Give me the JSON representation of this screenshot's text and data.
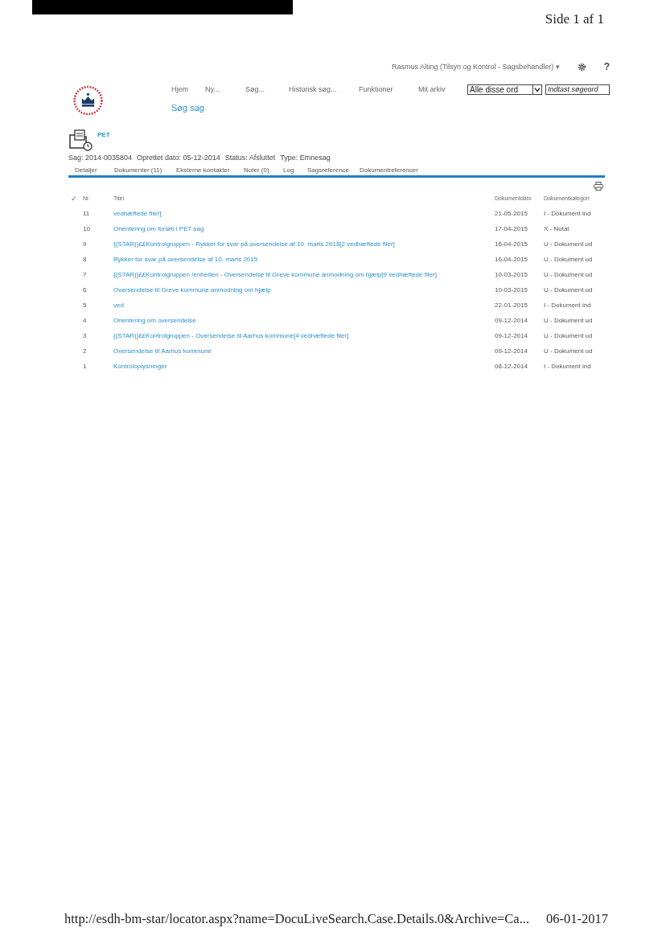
{
  "print_header": {
    "page": "Side 1 af 1"
  },
  "user_bar": {
    "user": "Rasmus Alting (Tilsyn og Kontrol - Sagsbehandler)",
    "caret": "▾",
    "help": "?"
  },
  "nav": {
    "items": [
      "Hjem",
      "Ny...",
      "Søg...",
      "Historisk søg...",
      "Funktioner",
      "Mit arkiv"
    ],
    "search_scope": "Alle disse ord",
    "search_placeholder": "Indtast søgeord",
    "sub_item": "Søg sag"
  },
  "case": {
    "label": "PET",
    "info": [
      {
        "label": "Sag:",
        "value": "2014-0035804"
      },
      {
        "label": "Oprettet dato:",
        "value": "05-12-2014"
      },
      {
        "label": "Status:",
        "value": "Afsluttet"
      },
      {
        "label": "Type:",
        "value": "Emnesag"
      }
    ]
  },
  "tabs": [
    "Detaljer",
    "Dokumenter (11)",
    "Eksterne kontakter",
    "Noter (0)",
    "Log",
    "Sagsreference",
    "Dokumentreferencer"
  ],
  "table": {
    "columns": [
      "✓",
      "Nr.",
      "Titel",
      "Dokumentdato",
      "Dokumentkategori"
    ],
    "rows": [
      {
        "nr": "11",
        "title": "vedhæftede filer]",
        "date": "21-05-2015",
        "category": "I - Dokument ind"
      },
      {
        "nr": "10",
        "title": "Orientering om forløb i PET sag",
        "date": "17-04-2015",
        "category": "X - Notat"
      },
      {
        "nr": "9",
        "title": "{(STAR)}££Kontrolgruppen - Rykker for svar på oversendelse af 10. marts 2015[2 vedhæftede filer]",
        "date": "16-04-2015",
        "category": "U - Dokument ud"
      },
      {
        "nr": "8",
        "title": "Rykker for svar på oversendelse af 10. marts 2015",
        "date": "16-04-2015",
        "category": "U - Dokument ud"
      },
      {
        "nr": "7",
        "title": "{(STAR)}££Kontrolgruppen /enheden - Oversendelse til Greve kommune anmodning om hjælp[9 vedhæftede filer]",
        "date": "10-03-2015",
        "category": "U - Dokument ud"
      },
      {
        "nr": "6",
        "title": "Oversendelse til Greve kommune anmodning om hjælp",
        "date": "10-03-2015",
        "category": "U - Dokument ud"
      },
      {
        "nr": "5",
        "title": "ved",
        "date": "22-01-2015",
        "category": "I - Dokument ind"
      },
      {
        "nr": "4",
        "title": "Orientering om oversendelse",
        "date": "09-12-2014",
        "category": "U - Dokument ud"
      },
      {
        "nr": "3",
        "title": "{(STAR)}££Kontrolgruppen - Oversendelse til Aarhus kommune[4 vedhæftede filer]",
        "date": "09-12-2014",
        "category": "U - Dokument ud"
      },
      {
        "nr": "2",
        "title": "Oversendelse til Aarhus kommune",
        "date": "09-12-2014",
        "category": "U - Dokument ud"
      },
      {
        "nr": "1",
        "title": "Kontroloplysninger",
        "date": "08-12-2014",
        "category": "I - Dokument ind"
      }
    ]
  },
  "print_footer": {
    "url": "http://esdh-bm-star/locator.aspx?name=DocuLiveSearch.Case.Details.0&Archive=Ca...",
    "date": "06-01-2017"
  }
}
